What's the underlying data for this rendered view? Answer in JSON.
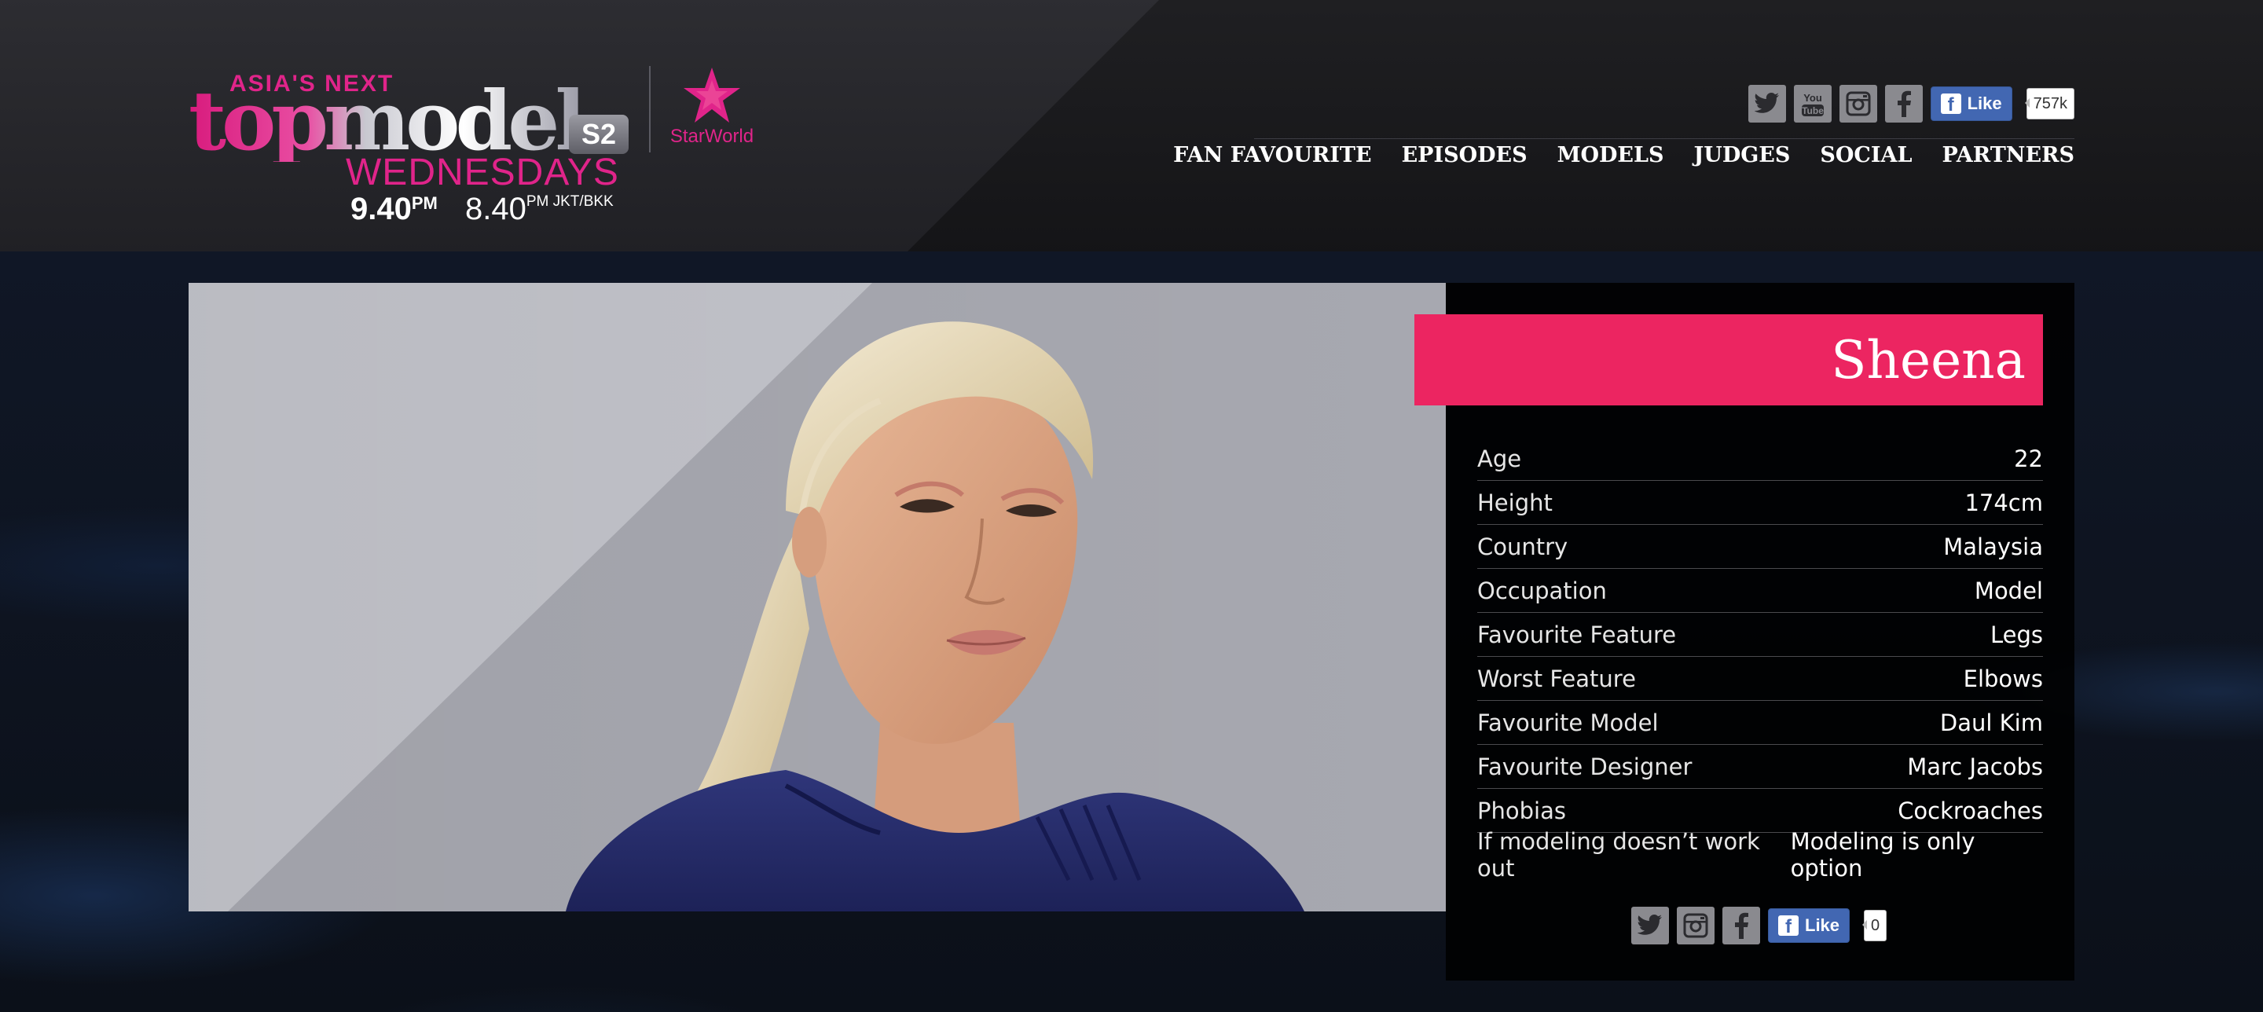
{
  "header": {
    "logo": {
      "line1": "ASIA'S NEXT",
      "line2": "topmodel",
      "season": "S2",
      "day": "WEDNESDAYS",
      "time1": "9.40",
      "time1_sup": "PM",
      "time2": "8.40",
      "time2_sup": "PM JKT/BKK"
    },
    "channel": "StarWorld",
    "social": {
      "icons": [
        "twitter-icon",
        "youtube-icon",
        "instagram-icon",
        "facebook-icon"
      ],
      "like_label": "Like",
      "like_count": "757k"
    },
    "nav": [
      "FAN FAVOURITE",
      "EPISODES",
      "MODELS",
      "JUDGES",
      "SOCIAL",
      "PARTNERS"
    ]
  },
  "profile": {
    "name": "Sheena",
    "stats": [
      {
        "label": "Age",
        "value": "22"
      },
      {
        "label": "Height",
        "value": "174cm"
      },
      {
        "label": "Country",
        "value": "Malaysia"
      },
      {
        "label": "Occupation",
        "value": "Model"
      },
      {
        "label": "Favourite Feature",
        "value": "Legs"
      },
      {
        "label": "Worst Feature",
        "value": "Elbows"
      },
      {
        "label": "Favourite Model",
        "value": "Daul Kim"
      },
      {
        "label": "Favourite Designer",
        "value": "Marc Jacobs"
      },
      {
        "label": "Phobias",
        "value": "Cockroaches"
      },
      {
        "label": "If modeling doesn’t work out",
        "value": "Modeling is only option"
      }
    ],
    "share": {
      "icons": [
        "twitter-icon",
        "instagram-icon",
        "facebook-icon"
      ],
      "like_label": "Like",
      "like_count": "0"
    }
  },
  "colors": {
    "accent_pink": "#ec2561",
    "logo_pink": "#e0248a",
    "facebook_blue": "#4267b2"
  }
}
